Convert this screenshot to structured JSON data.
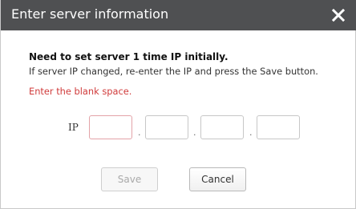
{
  "dialog": {
    "title": "Enter server information",
    "close_icon": "close-icon"
  },
  "message": {
    "heading": "Need to set server 1 time IP initially.",
    "instruction": "If server IP changed, re-enter the IP and press the Save button.",
    "error": "Enter the blank space."
  },
  "ip": {
    "label": "IP",
    "octets": [
      "",
      "",
      "",
      ""
    ],
    "separator": "."
  },
  "buttons": {
    "save_label": "Save",
    "save_enabled": false,
    "cancel_label": "Cancel"
  },
  "colors": {
    "titlebar": "#4f5052",
    "error_text": "#d03b3b",
    "error_border": "#e3a3a8"
  }
}
